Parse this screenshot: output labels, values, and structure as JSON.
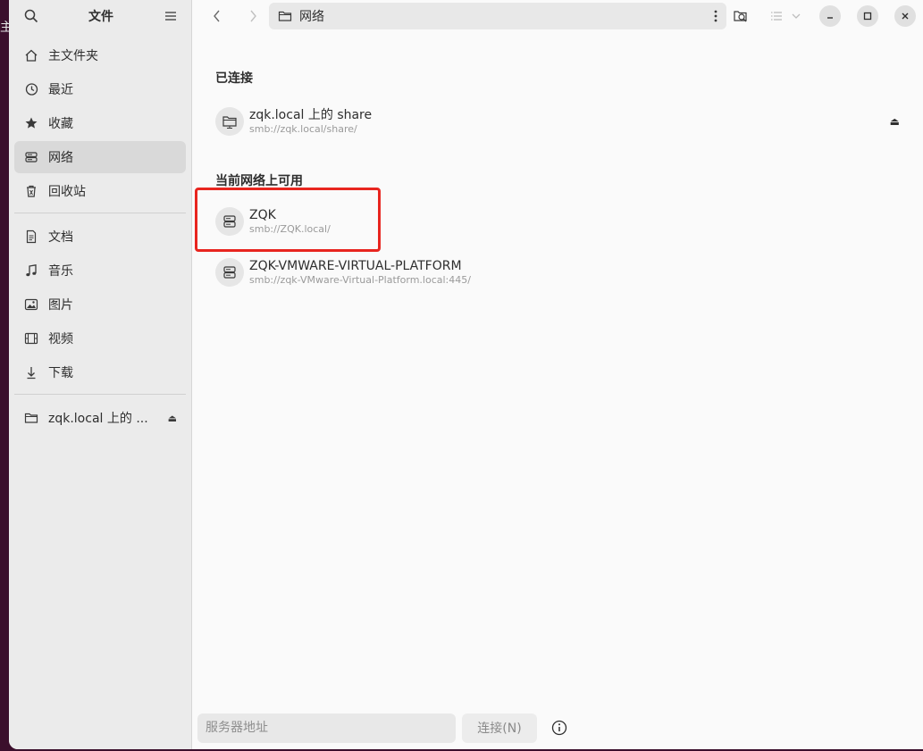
{
  "desktop_glyph": "主",
  "sidebar": {
    "title": "文件",
    "places": [
      {
        "label": "主文件夹",
        "icon": "home-icon"
      },
      {
        "label": "最近",
        "icon": "recent-icon"
      },
      {
        "label": "收藏",
        "icon": "star-icon"
      },
      {
        "label": "网络",
        "icon": "network-icon",
        "active": true
      },
      {
        "label": "回收站",
        "icon": "trash-icon"
      }
    ],
    "folders": [
      {
        "label": "文档",
        "icon": "document-icon"
      },
      {
        "label": "音乐",
        "icon": "music-icon"
      },
      {
        "label": "图片",
        "icon": "picture-icon"
      },
      {
        "label": "视频",
        "icon": "video-icon"
      },
      {
        "label": "下载",
        "icon": "download-icon"
      }
    ],
    "mounts": [
      {
        "label": "zqk.local 上的 ...",
        "icon": "folder-icon"
      }
    ]
  },
  "toolbar": {
    "location": "网络"
  },
  "main": {
    "connected_title": "已连接",
    "connected": [
      {
        "name": "zqk.local 上的 share",
        "uri": "smb://zqk.local/share/"
      }
    ],
    "available_title": "当前网络上可用",
    "available": [
      {
        "name": "ZQK",
        "uri": "smb://ZQK.local/"
      },
      {
        "name": "ZQK-VMWARE-VIRTUAL-PLATFORM",
        "uri": "smb://zqk-VMware-Virtual-Platform.local:445/"
      }
    ]
  },
  "bottom": {
    "server_placeholder": "服务器地址",
    "connect_label": "连接(N)"
  },
  "colors": {
    "highlight": "#e8251f",
    "sidebar_bg": "#ebebeb",
    "active_bg": "#d9d9d9"
  }
}
